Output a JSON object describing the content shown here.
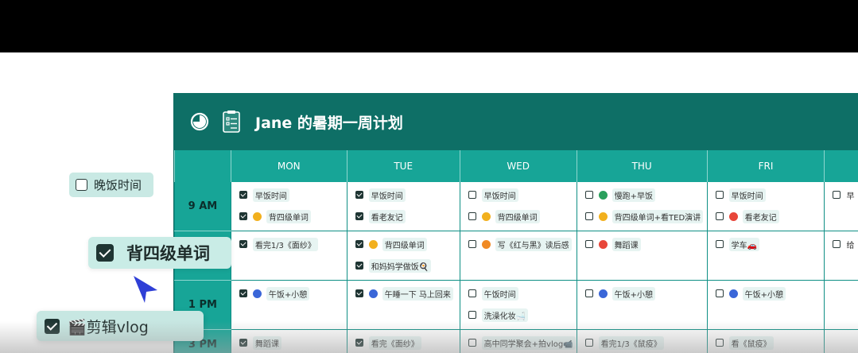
{
  "header": {
    "title": "Jane 的暑期一周计划"
  },
  "days": [
    "MON",
    "TUE",
    "WED",
    "THU",
    "FRI"
  ],
  "times": [
    "9 AM",
    "",
    "1 PM",
    "3 PM"
  ],
  "grid": [
    [
      [
        {
          "checked": true,
          "dot": null,
          "text": "早饭时间"
        },
        {
          "checked": true,
          "dot": "yellow",
          "text": "背四级单词"
        }
      ],
      [
        {
          "checked": true,
          "dot": null,
          "text": "早饭时间"
        },
        {
          "checked": true,
          "dot": null,
          "text": "看老友记"
        }
      ],
      [
        {
          "checked": false,
          "dot": null,
          "text": "早饭时间"
        },
        {
          "checked": false,
          "dot": "yellow",
          "text": "背四级单词"
        }
      ],
      [
        {
          "checked": false,
          "dot": "green",
          "text": "慢跑+早饭"
        },
        {
          "checked": false,
          "dot": "yellow",
          "text": "背四级单词+看TED演讲"
        }
      ],
      [
        {
          "checked": false,
          "dot": null,
          "text": "早饭时间"
        },
        {
          "checked": false,
          "dot": "red",
          "text": "看老友记"
        }
      ]
    ],
    [
      [
        {
          "checked": true,
          "dot": null,
          "text": "看完1/3《面纱》"
        }
      ],
      [
        {
          "checked": true,
          "dot": "yellow",
          "text": "背四级单词"
        },
        {
          "checked": true,
          "dot": null,
          "text": "和妈妈学做饭🍳"
        }
      ],
      [
        {
          "checked": false,
          "dot": "orange",
          "text": "写《红与黑》读后感"
        }
      ],
      [
        {
          "checked": false,
          "dot": "red",
          "text": "舞蹈课"
        }
      ],
      [
        {
          "checked": false,
          "dot": null,
          "text": "学车🚗"
        }
      ]
    ],
    [
      [
        {
          "checked": true,
          "dot": "blue",
          "text": "午饭+小憩"
        }
      ],
      [
        {
          "checked": true,
          "dot": "blue",
          "text": "午睡一下 马上回来"
        }
      ],
      [
        {
          "checked": false,
          "dot": null,
          "text": "午饭时间"
        },
        {
          "checked": false,
          "dot": null,
          "text": "洗澡化妆🛁"
        }
      ],
      [
        {
          "checked": false,
          "dot": "blue",
          "text": "午饭+小憩"
        }
      ],
      [
        {
          "checked": false,
          "dot": "blue",
          "text": "午饭+小憩"
        }
      ]
    ],
    [
      [
        {
          "checked": true,
          "dot": null,
          "text": "舞蹈课"
        }
      ],
      [
        {
          "checked": true,
          "dot": null,
          "text": "看完《面纱》"
        }
      ],
      [
        {
          "checked": false,
          "dot": null,
          "text": "高中同学聚会+拍vlog📹"
        }
      ],
      [
        {
          "checked": false,
          "dot": null,
          "text": "看完1/3《鼠疫》"
        }
      ],
      [
        {
          "checked": false,
          "dot": null,
          "text": "看《鼠疫》"
        }
      ]
    ]
  ],
  "partial_column": [
    "早",
    "给",
    "",
    ""
  ],
  "floating": {
    "dinner": {
      "text": "晚饭时间",
      "checked": false
    },
    "vocab": {
      "text": "背四级单词",
      "checked": true
    },
    "vlog": {
      "text": "🎬剪辑vlog",
      "checked": true
    }
  },
  "colors": {
    "header_bg": "#0e6f66",
    "day_header_bg": "#17a597",
    "accent": "#2f3fd6"
  }
}
